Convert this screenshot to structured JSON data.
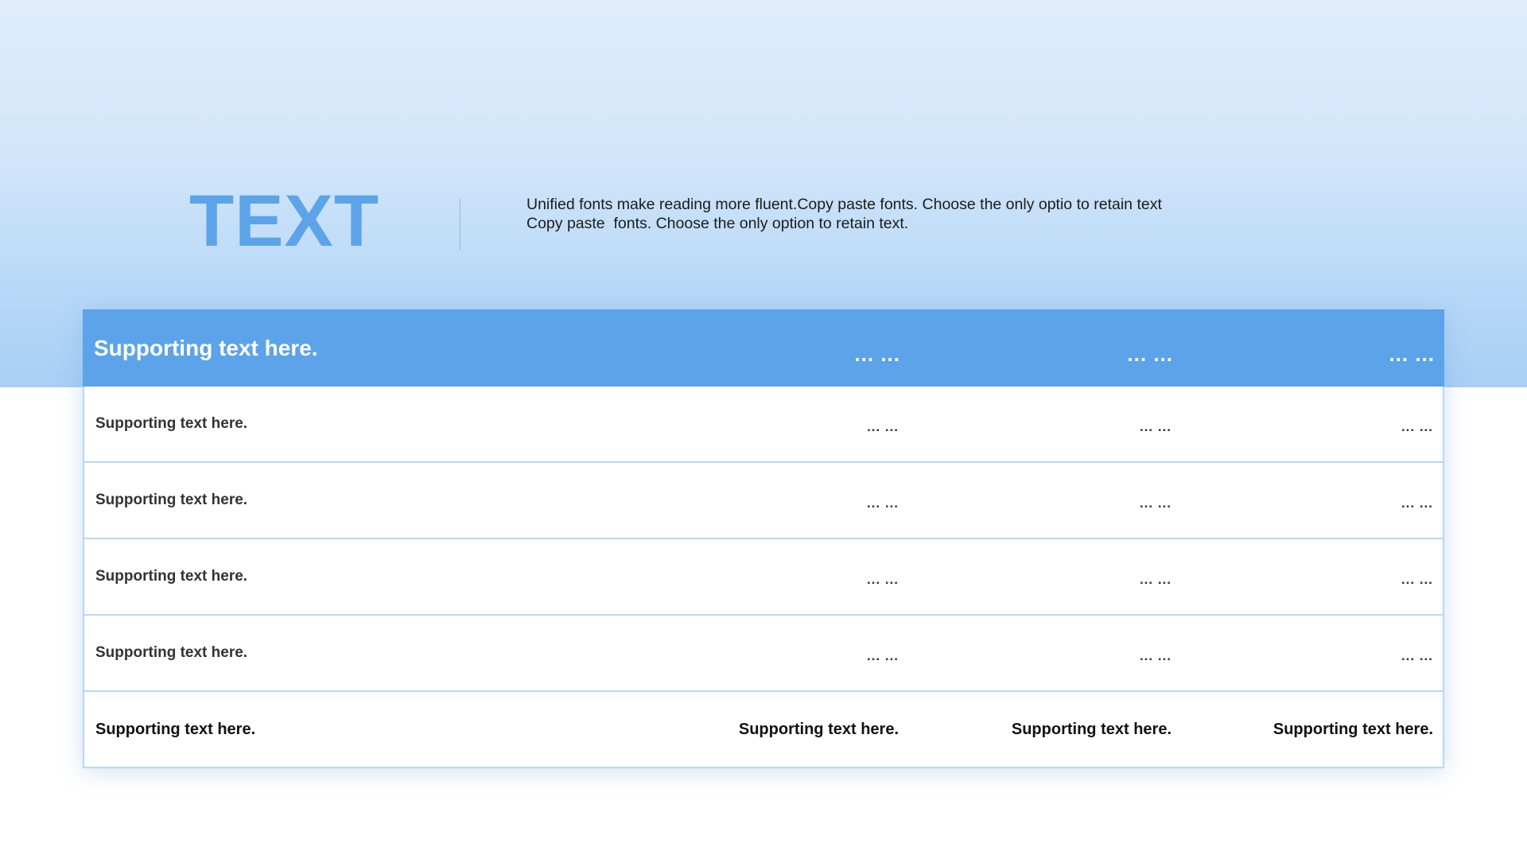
{
  "slide": {
    "title": "TEXT",
    "description_lines": [
      "Unified fonts make reading more fluent.Copy paste fonts. Choose the only optio to retain text",
      "Copy paste  fonts. Choose the only option to retain text."
    ]
  },
  "table": {
    "header": [
      "Supporting text here.",
      "... ...",
      "... ...",
      "... ..."
    ],
    "rows": [
      [
        "Supporting text here.",
        "... ...",
        "... ...",
        "... ..."
      ],
      [
        "Supporting text here.",
        "... ...",
        "... ...",
        "... ..."
      ],
      [
        "Supporting text here.",
        "... ...",
        "... ...",
        "... ..."
      ],
      [
        "Supporting text here.",
        "... ...",
        "... ...",
        "... ..."
      ]
    ],
    "footer": [
      "Supporting text here.",
      "Supporting text here.",
      "Supporting text here.",
      "Supporting text here."
    ]
  },
  "colors": {
    "accent": "#5ca3ea",
    "background_top": "#dfedfc",
    "background_bottom": "#a8cff5",
    "row_border": "#b9d6f3"
  }
}
